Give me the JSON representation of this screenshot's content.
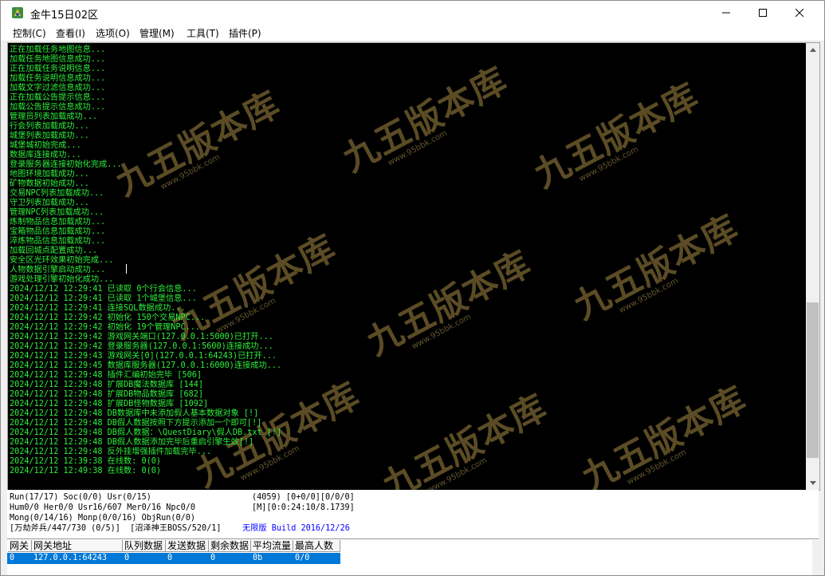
{
  "window": {
    "title": "金牛15日02区",
    "colors": {
      "console_bg": "#000000",
      "log_text": "#2cf03a",
      "selection": "#0078d7",
      "accent_text": "#0000ff"
    }
  },
  "menu": [
    {
      "label": "控制(C)"
    },
    {
      "label": "查看(I)"
    },
    {
      "label": "选项(O)"
    },
    {
      "label": "管理(M)"
    },
    {
      "label": "工具(T)"
    },
    {
      "label": "插件(P)"
    }
  ],
  "log": [
    "正在加载任务地图信息...",
    "加载任务地图信息成功...",
    "正在加载任务说明信息...",
    "加载任务说明信息成功...",
    "加载文字过滤信息成功...",
    "正在加载公告提示信息...",
    "加载公告提示信息成功...",
    "管理员列表加载成功...",
    "行会列表加载成功...",
    "城堡列表加载成功...",
    "城堡城初始完成...",
    "数据库连接成功...",
    "登录服务器连接初始化完成...",
    "地图环境加载成功...",
    "矿物数据初始成功...",
    "交易NPC列表加载成功...",
    "守卫列表加载成功...",
    "管理NPC列表加载成功...",
    "炼制物品信息加载成功...",
    "宝箱物品信息加载成功...",
    "淬炼物品信息加载成功...",
    "加载回城点配置成功...",
    "安全区光环效果初始完成...",
    "人物数据引擎启动成功...",
    "游戏处理引擎初始化成功...",
    "2024/12/12 12:29:41 已读取 0个行会信息...",
    "2024/12/12 12:29:41 已读取 1个城堡信息...",
    "2024/12/12 12:29:41 连接SQL数据成功...",
    "2024/12/12 12:29:42 初始化 150个交易NPC...",
    "2024/12/12 12:29:42 初始化 19个管理NPC...",
    "2024/12/12 12:29:42 游戏网关端口(127.0.0.1:5000)已打开...",
    "2024/12/12 12:29:42 登录服务器(127.0.0.1:5600)连接成功...",
    "2024/12/12 12:29:43 游戏网关[0](127.0.0.1:64243)已打开...",
    "2024/12/12 12:29:45 数据库服务器(127.0.0.1:6000)连接成功...",
    "2024/12/12 12:29:48 插件汇编初始完毕 [506]",
    "2024/12/12 12:29:48 扩展DB魔法数据库 [144]",
    "2024/12/12 12:29:48 扩展DB物品数据库 [682]",
    "2024/12/12 12:29:48 扩展DB怪物数据库 [1092]",
    "2024/12/12 12:29:48 DB数据库中未添加假人基本数据对象 [!]",
    "2024/12/12 12:29:48 DB假人数据按照下方提示添加一个即可[!]",
    "2024/12/12 12:29:48 DB假人数据：\\QuestDiary\\假人DB.txt [!]",
    "2024/12/12 12:29:48 DB假人数据添加完毕后重启引擎生效[!]",
    "2024/12/12 12:29:48 反外挂增强插件加载完毕...",
    "2024/12/12 12:39:38 在线数: 0(0)",
    "2024/12/12 12:49:38 在线数: 0(0)"
  ],
  "watermark": {
    "text": "九五版本库",
    "sub": "www.95bbk.com"
  },
  "scrollbar": {
    "position": 0.93,
    "visible_fraction": 0.37
  },
  "status": {
    "left": [
      "Run(17/17) Soc(0/0) Usr(0/15)",
      "Hum0/0 Her0/0 Usr16/607 Mer0/16 Npc0/0",
      "Mong(0/14/16) Monp(0/0/16) ObjRun(0/0)"
    ],
    "right": [
      "(4059) [0+0/0][0/0/0]",
      "[M][0:0:24:10/8.1739]"
    ],
    "bottom_prefix": "[万劫斧兵/447/730 (0/5)]  [沼泽神王BOSS/520/1]",
    "bottom_accent": "无限版 Build 2016/12/26"
  },
  "table": {
    "headers": [
      "网关",
      "网关地址",
      "队列数据",
      "发送数据",
      "剩余数据",
      "平均流量",
      "最高人数"
    ],
    "rows": [
      [
        "0",
        "127.0.0.1:64243",
        "0",
        "0",
        "0",
        "0b",
        "0/0"
      ]
    ]
  }
}
